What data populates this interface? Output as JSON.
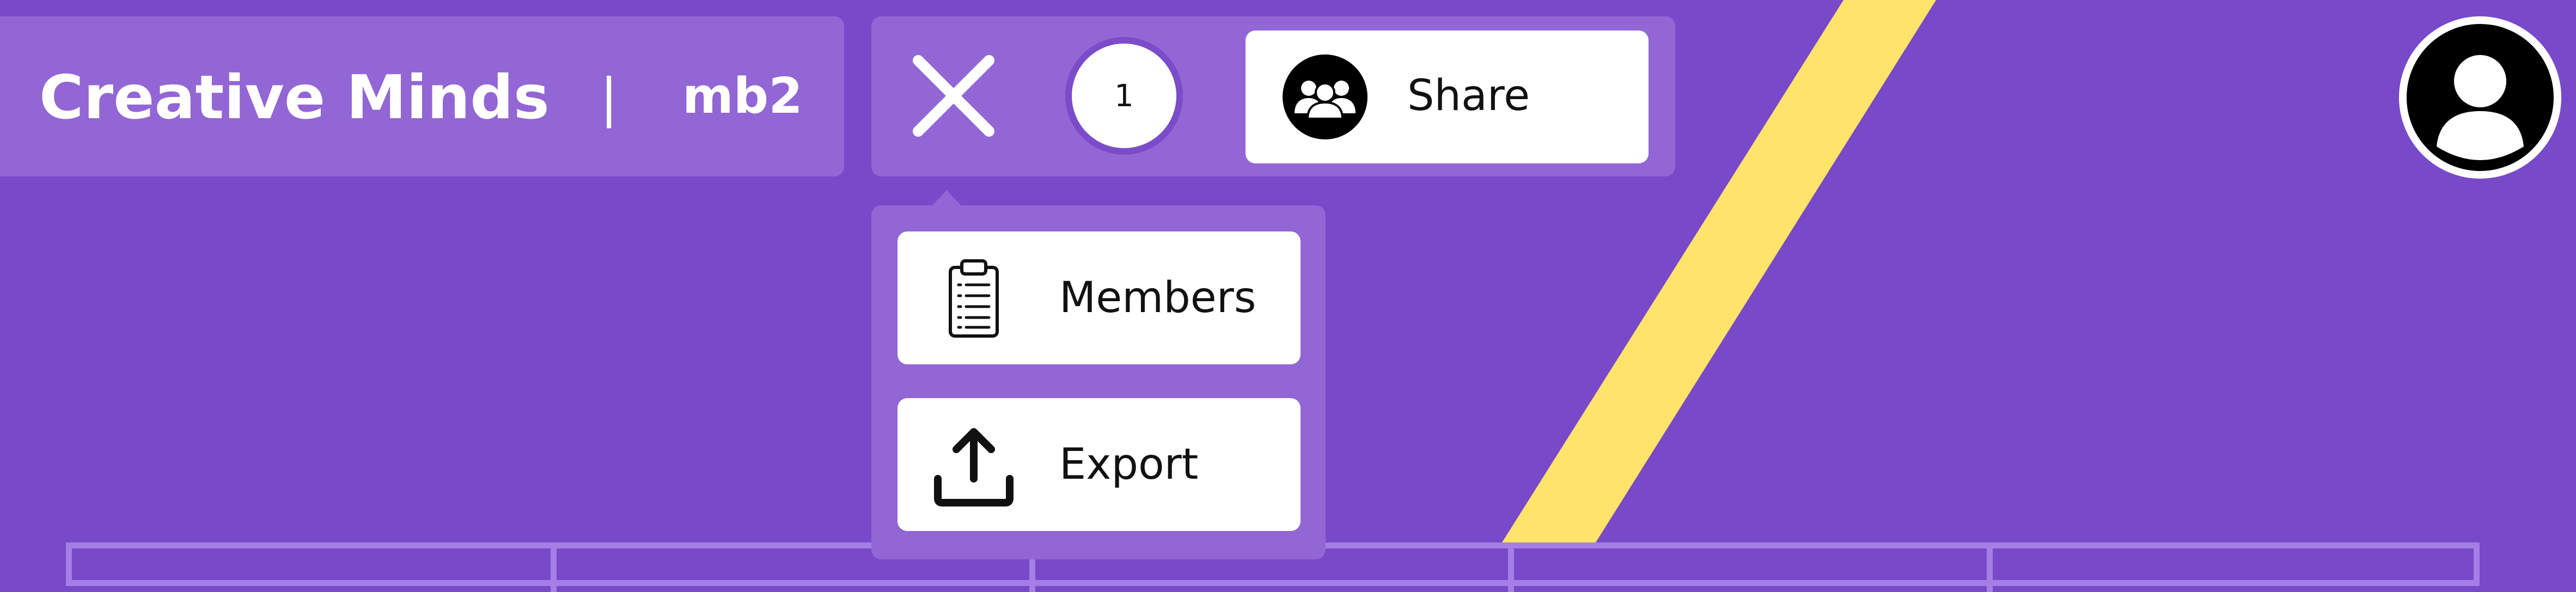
{
  "board": {
    "name": "Creative Minds",
    "separator": "|",
    "code": "mb2"
  },
  "toolbar": {
    "close_icon": "close-icon",
    "member_count": "1",
    "share_label": "Share",
    "share_icon": "group-icon"
  },
  "menu": {
    "items": [
      {
        "label": "Members",
        "icon": "clipboard-list-icon"
      },
      {
        "label": "Export",
        "icon": "upload-icon"
      }
    ]
  },
  "user": {
    "avatar_icon": "user-avatar-icon"
  },
  "colors": {
    "background": "#7849c9",
    "panel": "#9266d4",
    "stripe": "#ffe36a",
    "grid_line": "#a57ee6",
    "button_bg": "#ffffff",
    "text_dark": "#111111",
    "text_light": "#ffffff"
  }
}
